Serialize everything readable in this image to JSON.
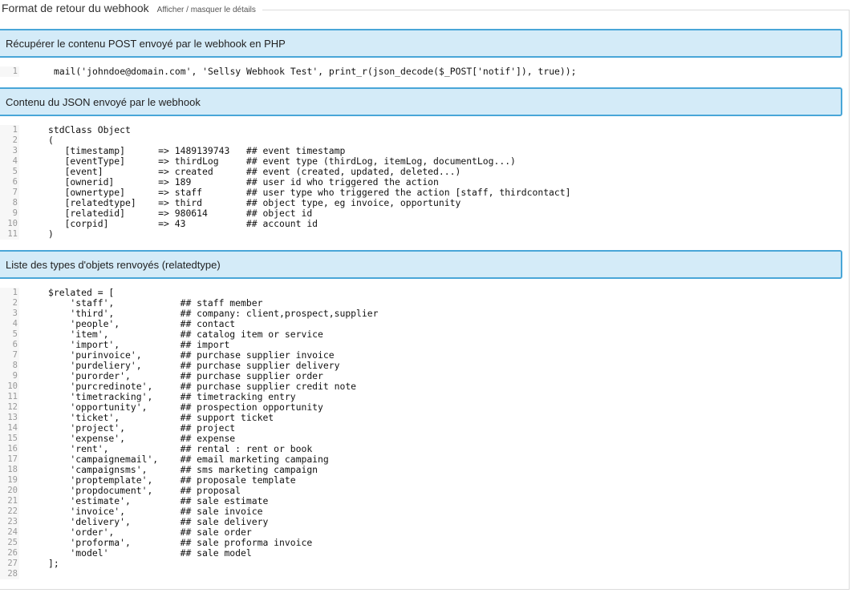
{
  "legend": {
    "title": "Format de retour du webhook",
    "toggle_label": "Afficher / masquer le détails"
  },
  "sections": [
    {
      "header": "Récupérer le contenu POST envoyé par le webhook en PHP",
      "code": [
        "mail('johndoe@domain.com', 'Sellsy Webhook Test', print_r(json_decode($_POST['notif']), true));"
      ]
    },
    {
      "header": "Contenu du JSON envoyé par le webhook",
      "code": [
        "stdClass Object",
        "(",
        "   [timestamp]      => 1489139743   ## event timestamp",
        "   [eventType]      => thirdLog     ## event type (thirdLog, itemLog, documentLog...)",
        "   [event]          => created      ## event (created, updated, deleted...)",
        "   [ownerid]        => 189          ## user id who triggered the action",
        "   [ownertype]      => staff        ## user type who triggered the action [staff, thirdcontact]",
        "   [relatedtype]    => third        ## object type, eg invoice, opportunity",
        "   [relatedid]      => 980614       ## object id",
        "   [corpid]         => 43           ## account id",
        ")"
      ]
    },
    {
      "header": "Liste des types d'objets renvoyés (relatedtype)",
      "code": [
        "$related = [",
        "    'staff',            ## staff member",
        "    'third',            ## company: client,prospect,supplier",
        "    'people',           ## contact",
        "    'item',             ## catalog item or service",
        "    'import',           ## import",
        "    'purinvoice',       ## purchase supplier invoice",
        "    'purdeliery',       ## purchase supplier delivery",
        "    'purorder',         ## purchase supplier order",
        "    'purcredinote',     ## purchase supplier credit note",
        "    'timetracking',     ## timetracking entry",
        "    'opportunity',      ## prospection opportunity",
        "    'ticket',           ## support ticket",
        "    'project',          ## project",
        "    'expense',          ## expense",
        "    'rent',             ## rental : rent or book",
        "    'campaignemail',    ## email marketing campaing",
        "    'campaignsms',      ## sms marketing campaign",
        "    'proptemplate',     ## proposale template",
        "    'propdocument',     ## proposal",
        "    'estimate',         ## sale estimate",
        "    'invoice',          ## sale invoice",
        "    'delivery',         ## sale delivery",
        "    'order',            ## sale order",
        "    'proforma',         ## sale proforma invoice",
        "    'model'             ## sale model",
        "];",
        ""
      ]
    }
  ]
}
